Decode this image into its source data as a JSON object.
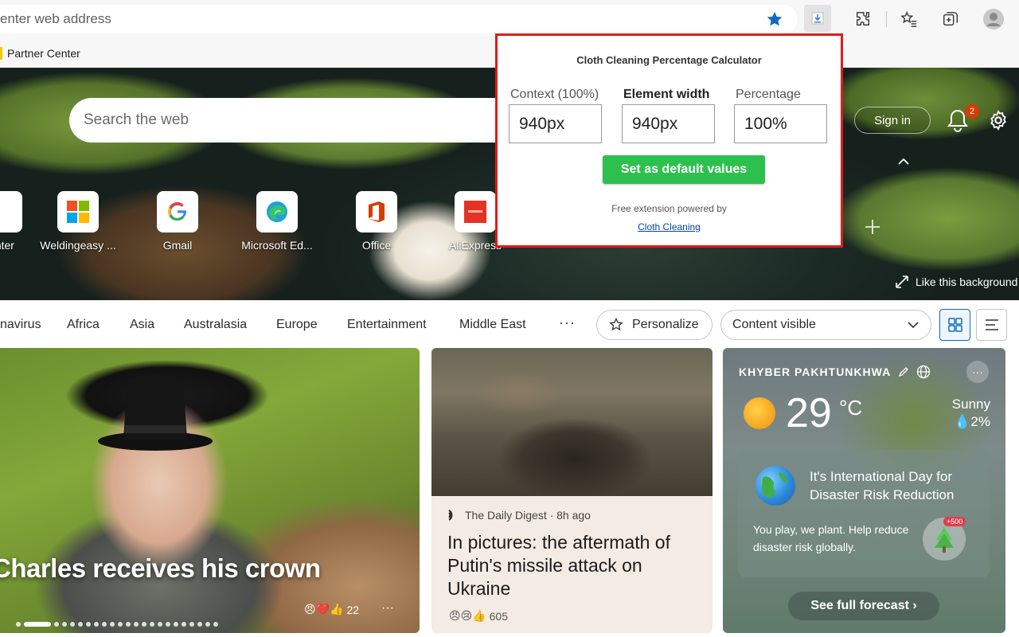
{
  "browser": {
    "address_placeholder": "enter web address",
    "bookmarks": [
      {
        "label": "Partner Center"
      }
    ]
  },
  "extension_popup": {
    "title": "Cloth Cleaning Percentage Calculator",
    "context_label": "Context (100%)",
    "context_value": "940px",
    "element_label": "Element width",
    "element_value": "940px",
    "percentage_label": "Percentage",
    "percentage_value": "100%",
    "default_button": "Set as default values",
    "powered_text": "Free extension powered by",
    "link_text": "Cloth Cleaning",
    "colors": {
      "border": "#e21b1b",
      "button": "#2ec04f",
      "link": "#0645ad"
    }
  },
  "hero": {
    "search_placeholder": "Search the web",
    "signin": "Sign in",
    "notification_count": "2",
    "tiles": [
      {
        "label": "enter",
        "icon": "tile-app-icon"
      },
      {
        "label": "Weldingeasy ...",
        "icon": "microsoft-logo-icon"
      },
      {
        "label": "Gmail",
        "icon": "google-logo-icon"
      },
      {
        "label": "Microsoft Ed...",
        "icon": "edge-logo-icon"
      },
      {
        "label": "Office",
        "icon": "office-logo-icon"
      },
      {
        "label": "AliExpress",
        "icon": "aliexpress-logo-icon"
      }
    ],
    "like_background": "Like this background"
  },
  "nav": {
    "items": [
      "navirus",
      "Africa",
      "Asia",
      "Australasia",
      "Europe",
      "Entertainment",
      "Middle East"
    ],
    "more": "···",
    "personalize": "Personalize",
    "content_select": "Content visible"
  },
  "cards": {
    "main": {
      "headline": "Charles receives his crown",
      "reactions": "22",
      "more": "···"
    },
    "news": {
      "source": "The Daily Digest · 8h ago",
      "headline": "In pictures: the aftermath of Putin's missile attack on Ukraine",
      "reactions": "605"
    },
    "weather": {
      "location": "KHYBER PAKHTUNKHWA",
      "temperature": "29",
      "unit": "°C",
      "condition": "Sunny",
      "precipitation": "💧2%",
      "promo_title": "It's International Day for Disaster Risk Reduction",
      "promo_text": "You play, we plant. Help reduce disaster risk globally.",
      "promo_badge": "+500",
      "forecast_button": "See full forecast ›"
    }
  }
}
